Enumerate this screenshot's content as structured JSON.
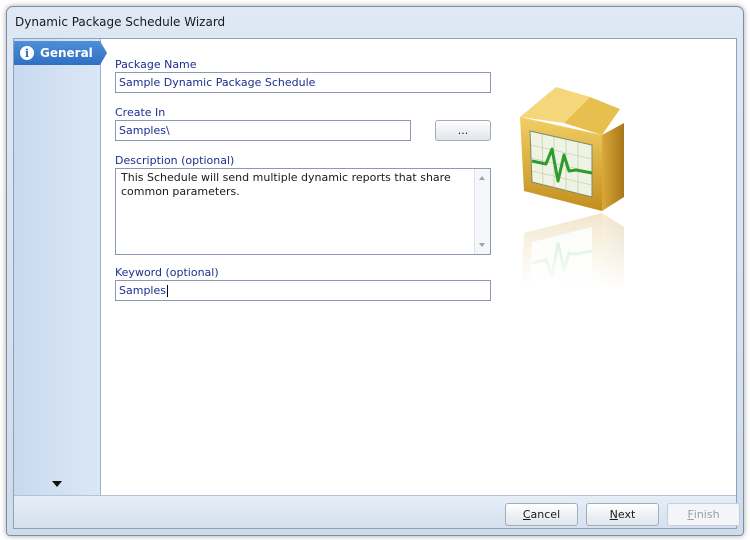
{
  "window": {
    "title": "Dynamic Package Schedule Wizard"
  },
  "sidebar": {
    "items": [
      {
        "label": "General",
        "icon": "info-icon",
        "selected": true
      }
    ],
    "scroll_icon": "chevron-down-icon"
  },
  "form": {
    "package_name": {
      "label": "Package Name",
      "value": "Sample Dynamic Package Schedule"
    },
    "create_in": {
      "label": "Create In",
      "value": "Samples\\",
      "browse_label": "..."
    },
    "description": {
      "label": "Description (optional)",
      "value": "This Schedule will send multiple dynamic reports that share common parameters."
    },
    "keyword": {
      "label": "Keyword (optional)",
      "value": "Samples"
    }
  },
  "illustration": {
    "icon": "package-box-icon"
  },
  "footer": {
    "cancel": {
      "mnemonic": "C",
      "rest": "ancel"
    },
    "next": {
      "mnemonic": "N",
      "rest": "ext"
    },
    "finish": {
      "mnemonic": "F",
      "rest": "inish",
      "disabled": true
    }
  },
  "colors": {
    "accent": "#2f6fc2",
    "label": "#1c2f8e"
  }
}
